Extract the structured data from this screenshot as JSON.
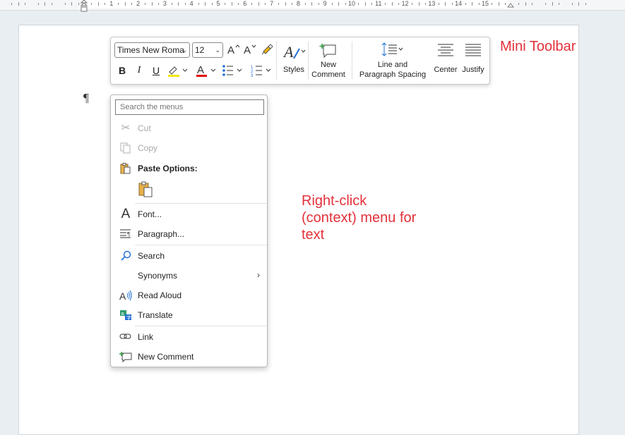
{
  "ruler": {
    "numbers": [
      "1",
      "2",
      "3",
      "4",
      "5",
      "6",
      "7",
      "8",
      "9",
      "10",
      "11",
      "12",
      "13",
      "14",
      "15"
    ]
  },
  "mini_toolbar": {
    "font_name": "Times New Roma",
    "font_size": "12",
    "grow_font_icon": "A^",
    "shrink_font_icon": "A˅",
    "bold": "B",
    "italic": "I",
    "underline": "U",
    "font_color_icon": "A",
    "styles_label": "Styles",
    "new_comment_label_1": "New",
    "new_comment_label_2": "Comment",
    "line_spacing_label_1": "Line and",
    "line_spacing_label_2": "Paragraph Spacing",
    "center_label": "Center",
    "justify_label": "Justify",
    "highlight_color": "#f2e600",
    "font_color": "#e00000"
  },
  "context_menu": {
    "search_placeholder": "Search the menus",
    "items": {
      "cut": "Cut",
      "copy": "Copy",
      "paste_options": "Paste Options:",
      "font": "Font...",
      "paragraph": "Paragraph...",
      "search": "Search",
      "synonyms": "Synonyms",
      "read_aloud": "Read Aloud",
      "translate": "Translate",
      "link": "Link",
      "new_comment": "New Comment"
    }
  },
  "annotations": {
    "mini_toolbar": "Mini Toolbar",
    "context_line1": "Right-click",
    "context_line2": "(context) menu for",
    "context_line3": "text"
  },
  "pilcrow": "¶"
}
